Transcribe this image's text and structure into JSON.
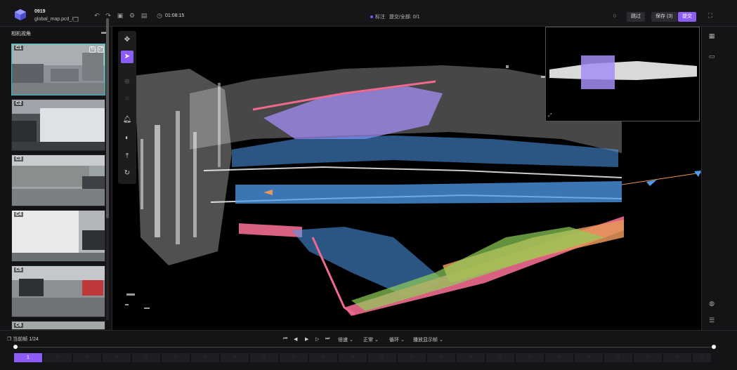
{
  "header": {
    "task_id": "0919",
    "file_name": "global_map.pcd_/",
    "timer": "01:08:15",
    "status_label": "标注",
    "progress_label": "提交/全部:",
    "progress_value": "0/1",
    "btn_skip": "跳过",
    "btn_save": "保存 (3)",
    "btn_submit": "提交"
  },
  "left_panel": {
    "title": "相机视角",
    "cameras": [
      "C1",
      "C2",
      "C3",
      "C4",
      "C5",
      "C6"
    ]
  },
  "toolbar_icons": [
    "rotate-3d-icon",
    "select-arrow-icon",
    "zoom-in-icon",
    "zoom-out-icon",
    "bell-icon",
    "contrast-icon",
    "upload-icon",
    "refresh-icon"
  ],
  "bottom": {
    "frame_label": "当前帧",
    "frame_value": "1/24",
    "speed_label": "倍速",
    "mode_label": "正常",
    "loop_label": "循环",
    "display_label": "播放显示帧",
    "current_frame": "1"
  },
  "colors": {
    "accent": "#8b5cf6",
    "active_border": "#37c3c6",
    "points_white": "#ffffff",
    "points_blue": "#4f9cf0",
    "points_pink": "#f06a8f",
    "points_green": "#8fcf57",
    "points_orange": "#e8975a",
    "points_purple": "#a48df5"
  }
}
